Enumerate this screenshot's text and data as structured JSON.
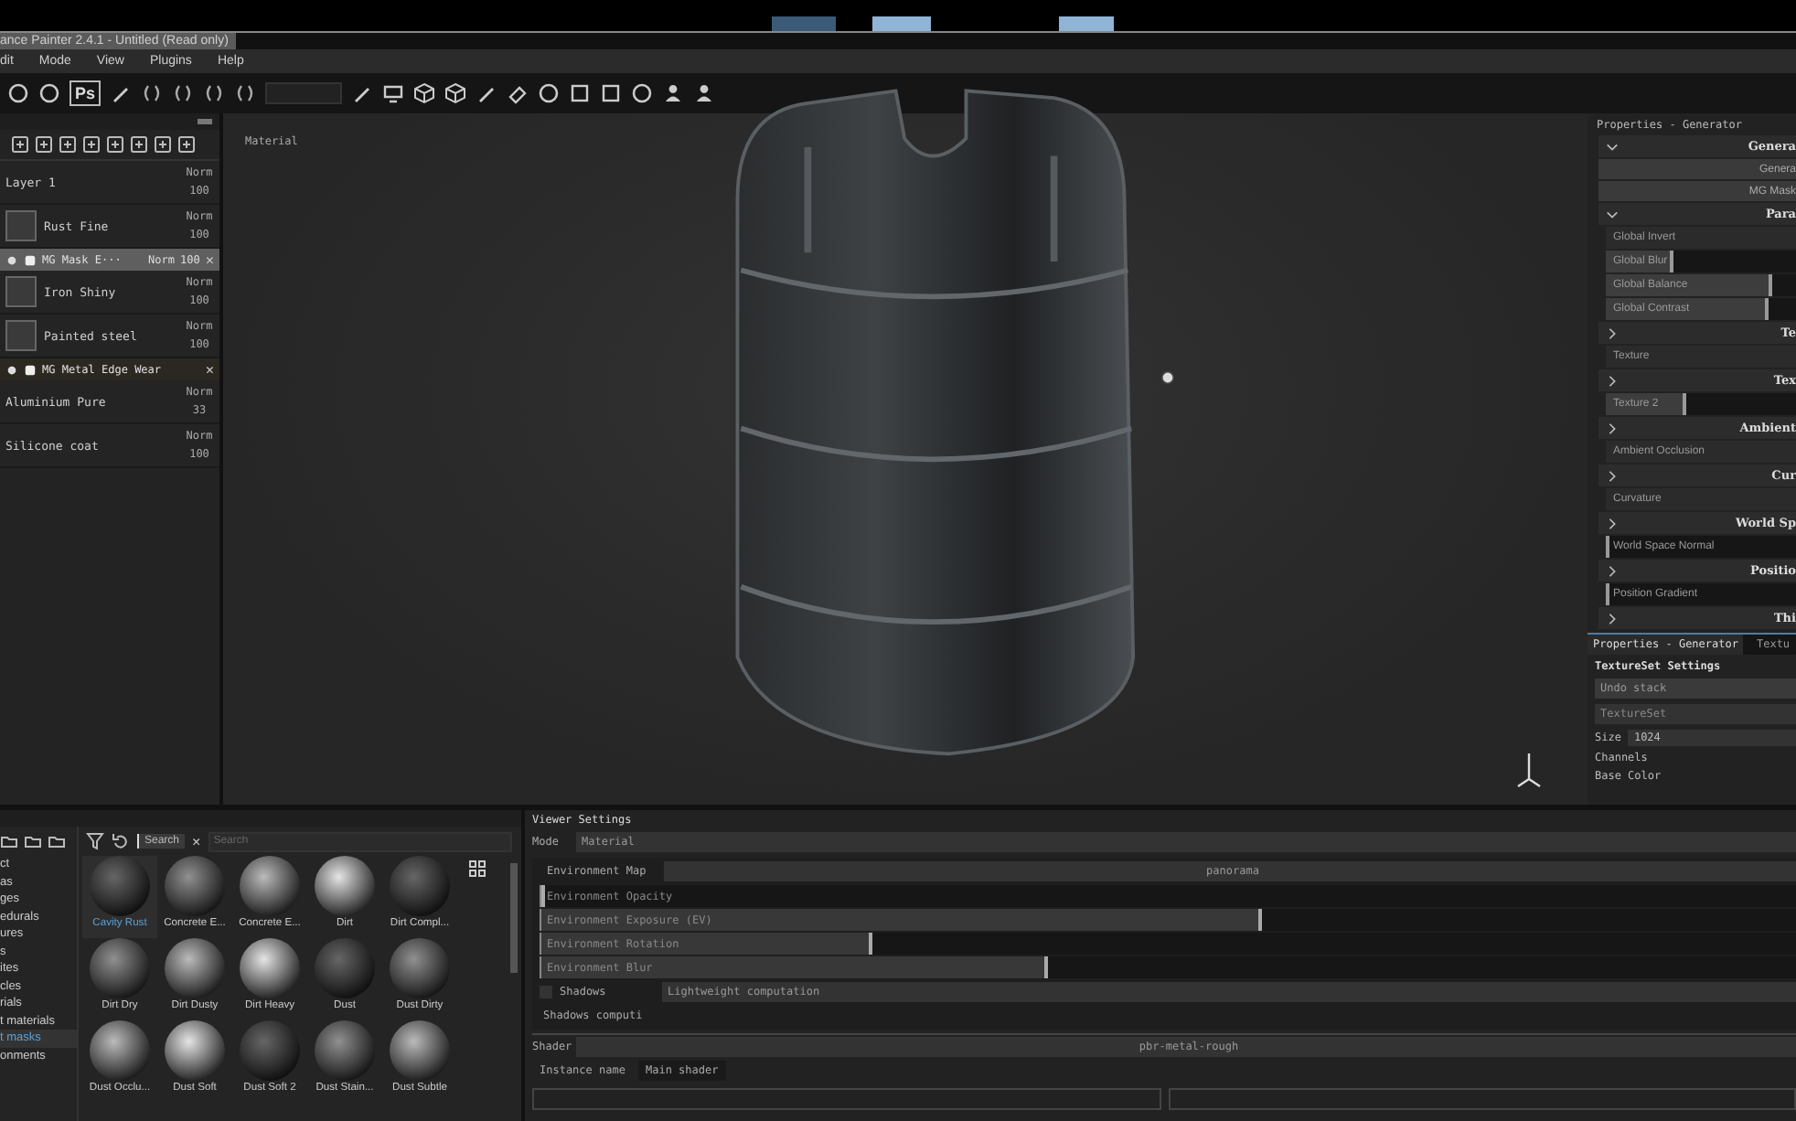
{
  "window": {
    "title": "ance Painter 2.4.1 - Untitled (Read only)"
  },
  "menu": [
    "dit",
    "Mode",
    "View",
    "Plugins",
    "Help"
  ],
  "toolbar": {
    "ps_label": "Ps"
  },
  "layers": [
    {
      "kind": "layer",
      "name": "Layer 1",
      "blend": "Norm",
      "opacity": "100",
      "thumbnail": false
    },
    {
      "kind": "layer",
      "name": "Rust Fine",
      "blend": "Norm",
      "opacity": "100",
      "thumbnail": true
    },
    {
      "kind": "effect",
      "name": "MG Mask E···",
      "blend": "Norm",
      "opacity": "100",
      "close": "×",
      "selected": true
    },
    {
      "kind": "layer",
      "name": "Iron Shiny",
      "blend": "Norm",
      "opacity": "100",
      "thumbnail": true
    },
    {
      "kind": "layer",
      "name": "Painted steel",
      "blend": "Norm",
      "opacity": "100",
      "thumbnail": true
    },
    {
      "kind": "effect",
      "name": "MG Metal Edge Wear",
      "close": "×",
      "selected": false
    },
    {
      "kind": "layer",
      "name": "Aluminium Pure",
      "blend": "Norm",
      "opacity": "33",
      "thumbnail": false
    },
    {
      "kind": "layer",
      "name": "Silicone coat",
      "blend": "Norm",
      "opacity": "100",
      "thumbnail": false
    }
  ],
  "viewport": {
    "label": "Material"
  },
  "properties": {
    "title": "Properties - Generator",
    "items": [
      {
        "kind": "group",
        "label": "Genera",
        "expanded": true
      },
      {
        "kind": "info",
        "label": "Genera"
      },
      {
        "kind": "info",
        "label": "MG Mask"
      },
      {
        "kind": "group",
        "label": "Para",
        "expanded": true
      },
      {
        "kind": "field",
        "label": "Global Invert"
      },
      {
        "kind": "slider",
        "label": "Global Blur",
        "level": 0.34
      },
      {
        "kind": "slider",
        "label": "Global Balance",
        "level": 0.86
      },
      {
        "kind": "slider",
        "label": "Global Contrast",
        "level": 0.84
      },
      {
        "kind": "group",
        "label": "Te",
        "expanded": false
      },
      {
        "kind": "field",
        "label": "Texture"
      },
      {
        "kind": "group",
        "label": "Tex",
        "expanded": false
      },
      {
        "kind": "slider",
        "label": "Texture 2",
        "level": 0.4
      },
      {
        "kind": "group",
        "label": "Ambient",
        "expanded": false
      },
      {
        "kind": "field",
        "label": "Ambient Occlusion"
      },
      {
        "kind": "group",
        "label": "Cur",
        "expanded": false
      },
      {
        "kind": "field",
        "label": "Curvature"
      },
      {
        "kind": "group",
        "label": "World Sp",
        "expanded": false
      },
      {
        "kind": "slider",
        "label": "World Space Normal",
        "level": 0
      },
      {
        "kind": "group",
        "label": "Positio",
        "expanded": false
      },
      {
        "kind": "slider",
        "label": "Position Gradient",
        "level": 0
      },
      {
        "kind": "group",
        "label": "Thi",
        "expanded": false
      }
    ]
  },
  "panel_tabs": [
    {
      "label": "Properties - Generator",
      "selected": true
    },
    {
      "label": "Textu",
      "selected": false
    }
  ],
  "texture_set": {
    "title": "TextureSet Settings",
    "undo": "Undo stack",
    "field": "TextureSet",
    "size_label": "Size",
    "size_value": "1024",
    "channels": "Channels",
    "base_color": "Base Color"
  },
  "shelf": {
    "categories": [
      {
        "label": "ct",
        "selected": false
      },
      {
        "label": "as",
        "selected": false
      },
      {
        "label": "ges",
        "selected": false
      },
      {
        "label": "edurals",
        "selected": false
      },
      {
        "label": "ures",
        "selected": false
      },
      {
        "label": "s",
        "selected": false
      },
      {
        "label": "ites",
        "selected": false
      },
      {
        "label": "cles",
        "selected": false
      },
      {
        "label": "rials",
        "selected": false
      },
      {
        "label": "t materials",
        "selected": false
      },
      {
        "label": "t masks",
        "selected": true
      },
      {
        "label": "onments",
        "selected": false
      }
    ],
    "filter_chip": "Search",
    "filter_close": "×",
    "search_placeholder": "Search",
    "items": [
      {
        "name": "Cavity Rust",
        "selected": true
      },
      {
        "name": "Concrete E...",
        "selected": false
      },
      {
        "name": "Concrete E...",
        "selected": false
      },
      {
        "name": "Dirt",
        "selected": false
      },
      {
        "name": "Dirt Compl...",
        "selected": false
      },
      {
        "name": "Dirt Dry",
        "selected": false
      },
      {
        "name": "Dirt Dusty",
        "selected": false
      },
      {
        "name": "Dirt Heavy",
        "selected": false
      },
      {
        "name": "Dust",
        "selected": false
      },
      {
        "name": "Dust Dirty",
        "selected": false
      },
      {
        "name": "Dust Occlu...",
        "selected": false
      },
      {
        "name": "Dust Soft",
        "selected": false
      },
      {
        "name": "Dust Soft 2",
        "selected": false
      },
      {
        "name": "Dust Stain...",
        "selected": false
      },
      {
        "name": "Dust Subtle",
        "selected": false
      }
    ]
  },
  "viewer": {
    "title": "Viewer Settings",
    "mode_label": "Mode",
    "mode_value": "Material",
    "env_label": "Environment Map",
    "env_value": "panorama",
    "sliders": [
      {
        "label": "Environment Opacity",
        "level": 0
      },
      {
        "label": "Environment Exposure (EV)",
        "level": 0.57
      },
      {
        "label": "Environment Rotation",
        "level": 0.26
      },
      {
        "label": "Environment Blur",
        "level": 0.4
      }
    ],
    "shadows": {
      "label": "Shadows",
      "checked": false,
      "value": "Lightweight computation"
    },
    "shadows_computation": "Shadows computi",
    "shader_label": "Shader",
    "shader_value": "pbr-metal-rough",
    "instance_label": "Instance name",
    "instance_value": "Main shader"
  }
}
